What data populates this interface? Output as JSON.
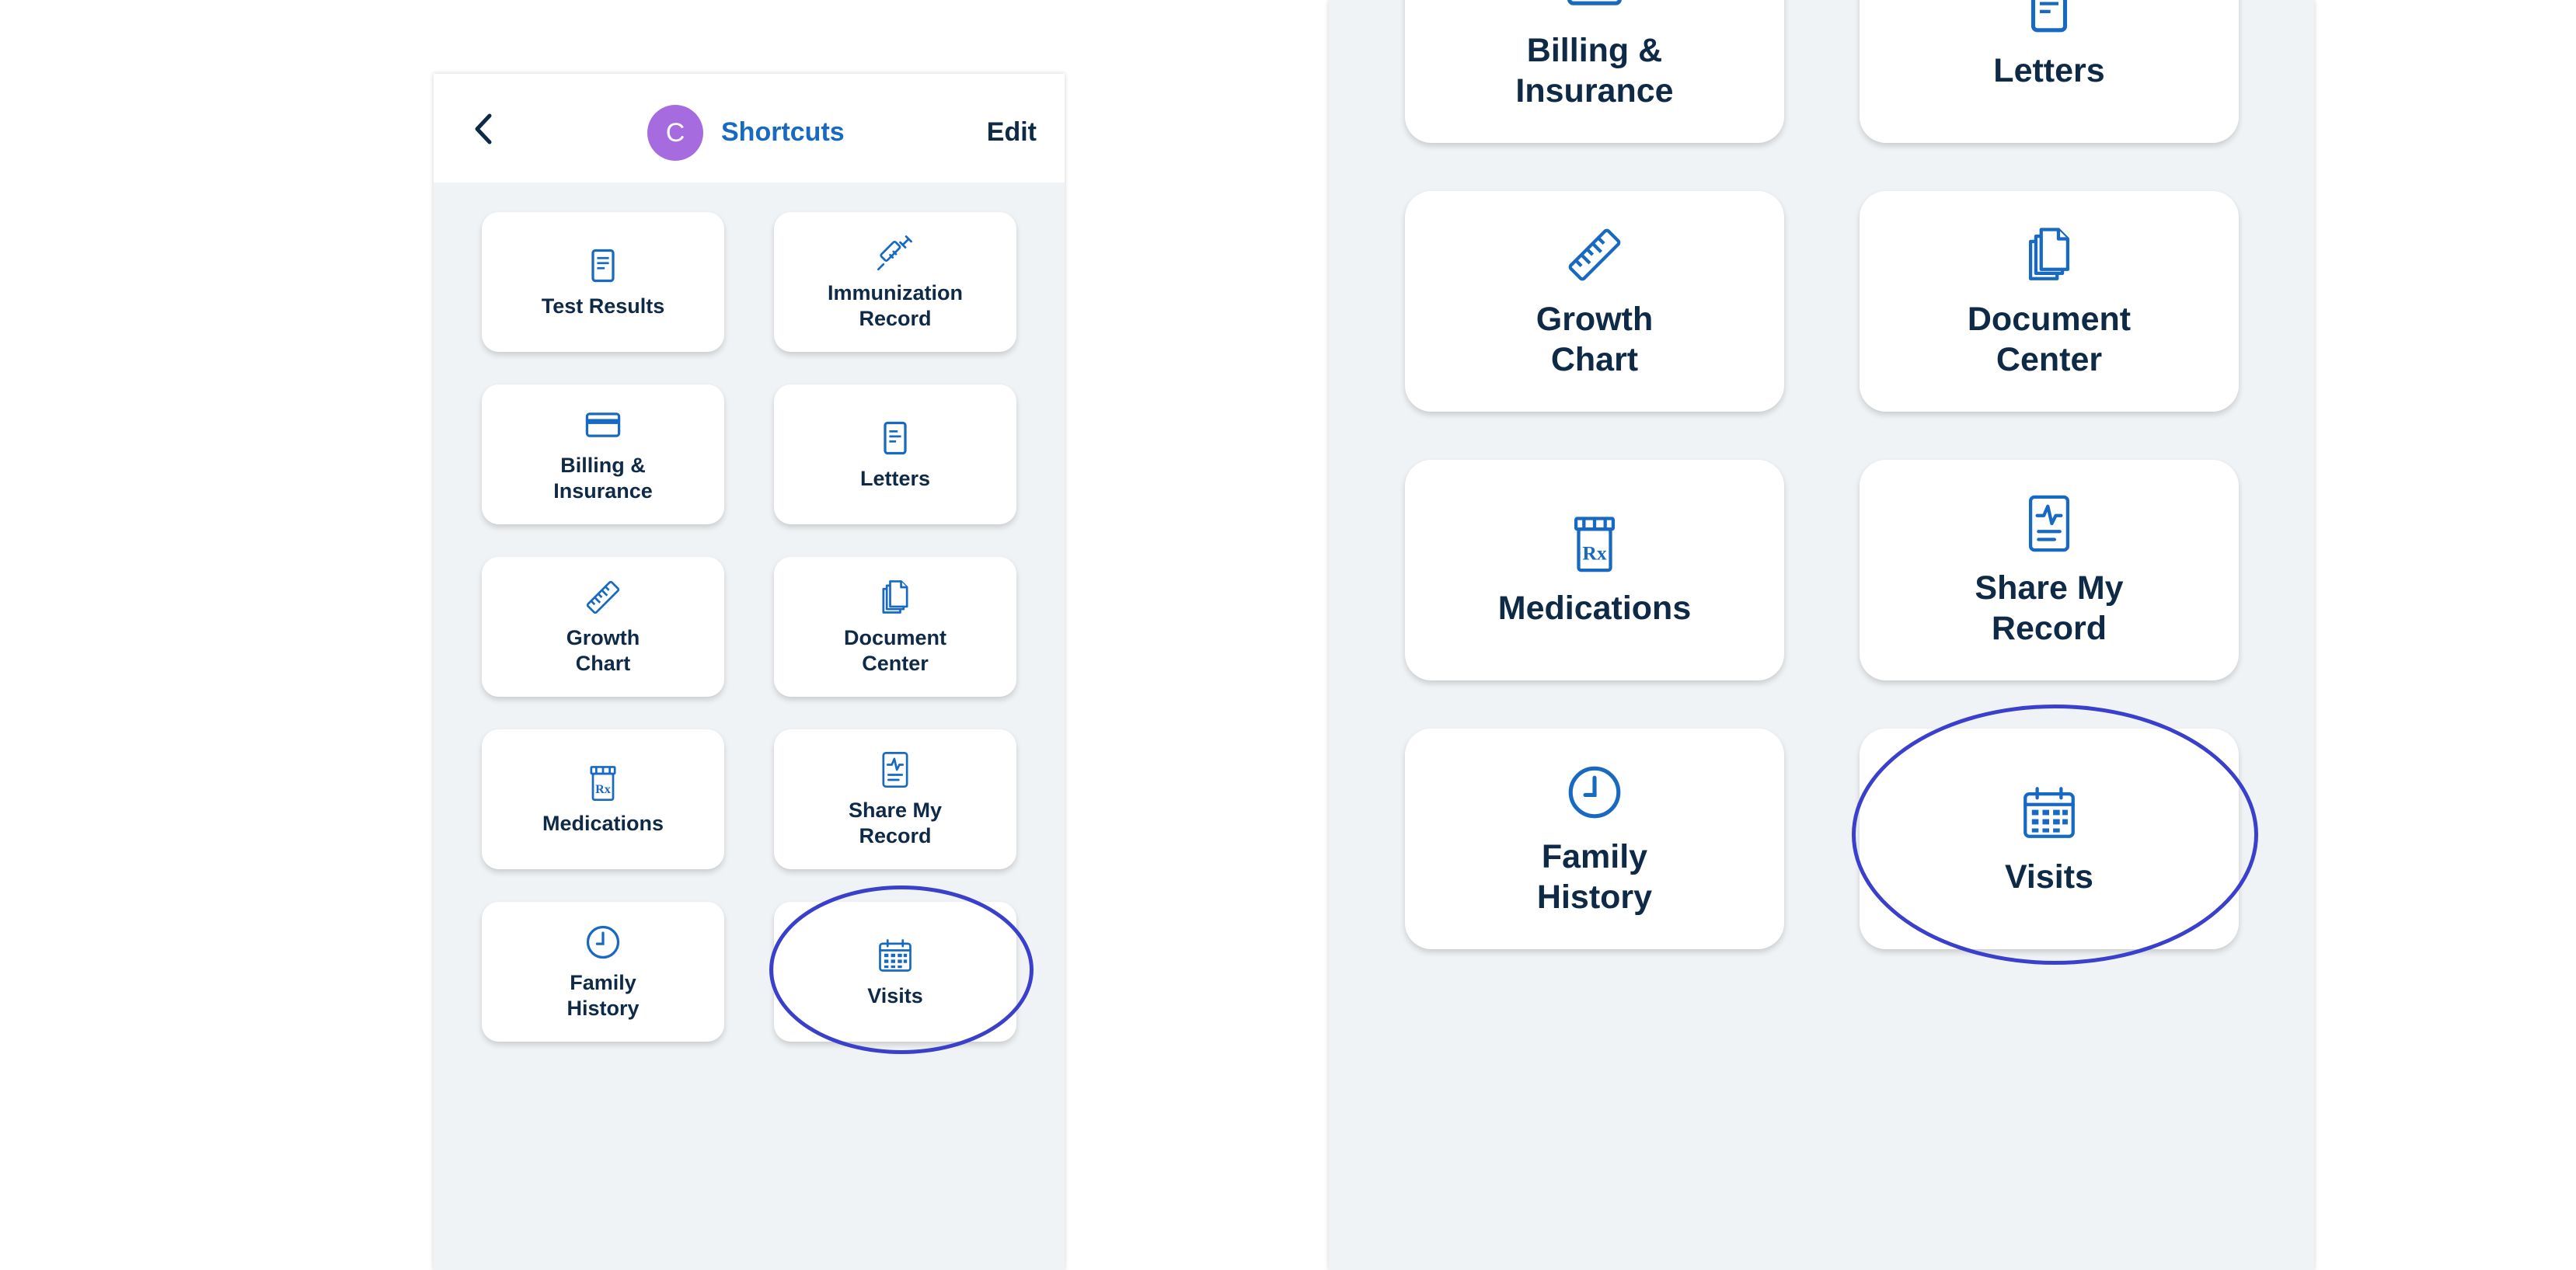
{
  "header": {
    "avatar_initial": "C",
    "title": "Shortcuts",
    "edit_label": "Edit",
    "back_icon": "chevron-left-icon"
  },
  "shortcuts": [
    {
      "label": "Test Results",
      "icon": "document-icon"
    },
    {
      "label": "Immunization\nRecord",
      "icon": "syringe-icon"
    },
    {
      "label": "Billing &\nInsurance",
      "icon": "credit-card-icon"
    },
    {
      "label": "Letters",
      "icon": "letter-icon"
    },
    {
      "label": "Growth\nChart",
      "icon": "ruler-icon"
    },
    {
      "label": "Document\nCenter",
      "icon": "documents-icon"
    },
    {
      "label": "Medications",
      "icon": "pill-bottle-icon"
    },
    {
      "label": "Share My\nRecord",
      "icon": "health-record-icon"
    },
    {
      "label": "Family\nHistory",
      "icon": "clock-icon"
    },
    {
      "label": "Visits",
      "icon": "calendar-icon"
    }
  ],
  "colors": {
    "accent": "#1769c2",
    "text_dark": "#0e2a47",
    "avatar": "#a76be0",
    "panel_bg": "#f0f3f5",
    "highlight": "#3a3fcc"
  }
}
